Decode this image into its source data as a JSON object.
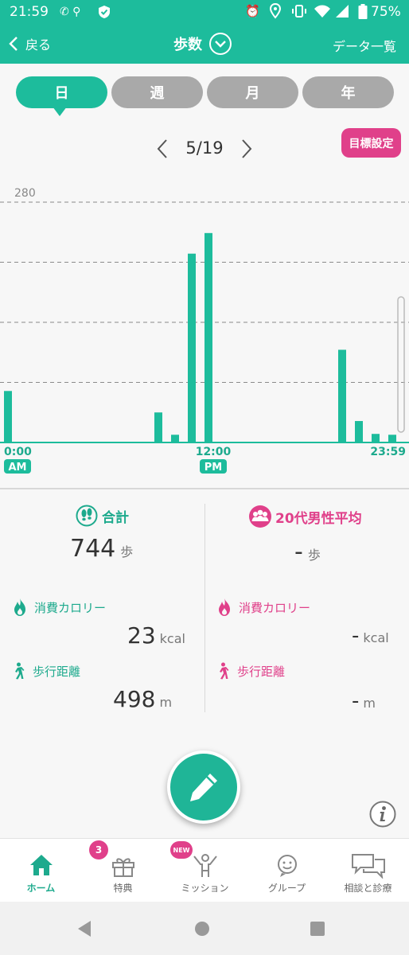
{
  "status_bar": {
    "time": "21:59",
    "battery": "75%"
  },
  "header": {
    "back_label": "戻る",
    "title": "歩数",
    "data_list_label": "データ一覧"
  },
  "tabs": [
    {
      "label": "日",
      "active": true
    },
    {
      "label": "週",
      "active": false
    },
    {
      "label": "月",
      "active": false
    },
    {
      "label": "年",
      "active": false
    }
  ],
  "date_nav": {
    "date": "5/19"
  },
  "goal_button": {
    "label": "目標設定"
  },
  "chart_data": {
    "type": "bar",
    "y_max_label": "280",
    "ylim": [
      0,
      280
    ],
    "gridlines": [
      70,
      140,
      210,
      280
    ],
    "x_ticks": [
      {
        "label": "0:00",
        "badge": "AM"
      },
      {
        "label": "12:00",
        "badge": "PM"
      },
      {
        "label": "23:59",
        "badge": ""
      }
    ],
    "categories": [
      "0",
      "1",
      "2",
      "3",
      "4",
      "5",
      "6",
      "7",
      "8",
      "9",
      "10",
      "11",
      "12",
      "13",
      "14",
      "15",
      "16",
      "17",
      "18",
      "19",
      "20",
      "21",
      "22",
      "23"
    ],
    "values": [
      60,
      0,
      0,
      0,
      0,
      0,
      0,
      0,
      0,
      35,
      9,
      220,
      244,
      0,
      0,
      0,
      0,
      0,
      0,
      0,
      108,
      25,
      10,
      9
    ],
    "color": "#1dbc9c"
  },
  "summary": {
    "total": {
      "title": "合計",
      "steps": "744",
      "steps_unit": "歩",
      "calories_label": "消費カロリー",
      "calories": "23",
      "calories_unit": "kcal",
      "distance_label": "歩行距離",
      "distance": "498",
      "distance_unit": "m"
    },
    "average": {
      "title": "20代男性平均",
      "steps": "-",
      "steps_unit": "歩",
      "calories_label": "消費カロリー",
      "calories": "-",
      "calories_unit": "kcal",
      "distance_label": "歩行距離",
      "distance": "-",
      "distance_unit": "m"
    }
  },
  "bottom_nav": [
    {
      "label": "ホーム",
      "icon": "home-icon",
      "active": true
    },
    {
      "label": "特典",
      "icon": "gift-icon",
      "badge": "3"
    },
    {
      "label": "ミッション",
      "icon": "mission-icon",
      "badge": "NEW"
    },
    {
      "label": "グループ",
      "icon": "group-icon"
    },
    {
      "label": "相談と診療",
      "icon": "consult-icon"
    }
  ],
  "colors": {
    "primary": "#1dbc9c",
    "accent_pink": "#e0408a",
    "inactive_tab": "#a9a9a9"
  }
}
